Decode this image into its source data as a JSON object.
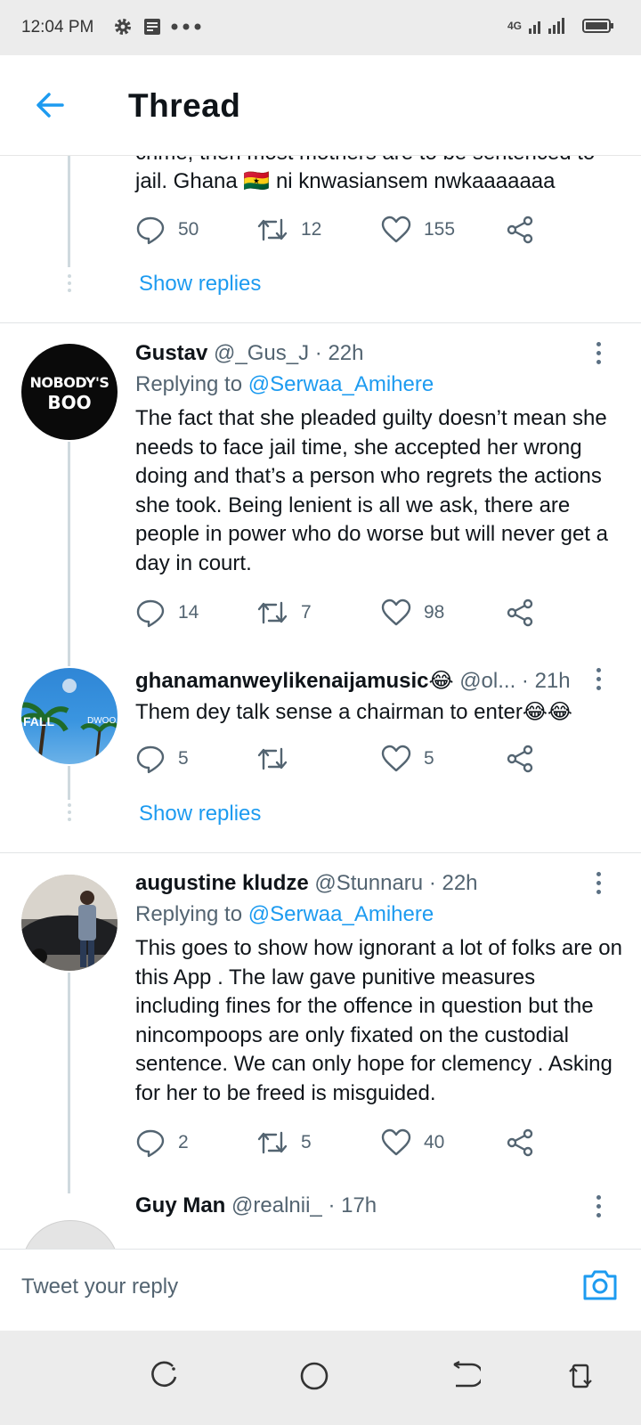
{
  "status": {
    "time": "12:04 PM",
    "network": "4G"
  },
  "header": {
    "title": "Thread"
  },
  "top_tweet": {
    "text_clipped": "crime, then most mothers are to be sentenced to",
    "text_line2": "jail. Ghana 🇬🇭 ni knwasiansem nwkaaaaaaa",
    "replies": "50",
    "retweets": "12",
    "likes": "155",
    "show_replies": "Show replies"
  },
  "tweets": [
    {
      "name": "Gustav",
      "handle": "@_Gus_J",
      "time": "· 22h",
      "replying_label": "Replying to",
      "replying_handle": "@Serwaa_Amihere",
      "avatar_text_1": "NOBODY'S",
      "avatar_text_2": "BOO",
      "body": "The fact that she pleaded guilty doesn’t mean she needs to face jail time, she accepted her wrong doing and that’s a person who regrets the actions she took. Being lenient is all we ask, there are people in power who do worse but will never get a day in court.",
      "replies": "14",
      "retweets": "7",
      "likes": "98"
    },
    {
      "name": "ghanamanweylikenaijamusic😂",
      "handle": "@ol...",
      "time": "· 21h",
      "avatar_text_1": "FALL",
      "avatar_text_2": "DWOO",
      "body": "Them dey talk sense a chairman to enter😂😂",
      "replies": "5",
      "retweets": "",
      "likes": "5",
      "show_replies": "Show replies"
    },
    {
      "name": "augustine kludze",
      "handle": "@Stunnaru",
      "time": "· 22h",
      "replying_label": "Replying to",
      "replying_handle": "@Serwaa_Amihere",
      "body": "This goes to show how ignorant a lot of folks are on this App . The law gave punitive measures including fines for the offence in question but the nincompoops are only fixated on the custodial sentence. We can only hope for clemency . Asking for her to be freed is misguided.",
      "replies": "2",
      "retweets": "5",
      "likes": "40"
    },
    {
      "name": "Guy Man",
      "handle": "@realnii_",
      "time": "· 17h"
    }
  ],
  "reply_box": {
    "placeholder": "Tweet your reply"
  },
  "colors": {
    "accent": "#1d9bf0",
    "text": "#0f1419",
    "muted": "#536471"
  }
}
